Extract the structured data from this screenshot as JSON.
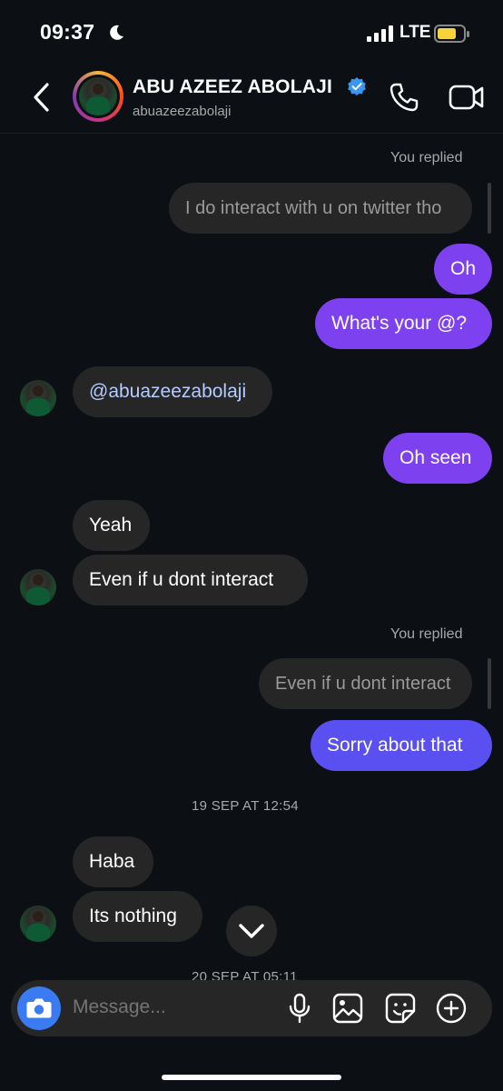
{
  "status_bar": {
    "time": "09:37",
    "network": "LTE"
  },
  "header": {
    "name": "ABU AZEEZ ABOLAJI",
    "username": "abuazeezabolaji"
  },
  "messages": {
    "reply1_label": "You replied",
    "reply1_quote": "I do interact with u on twitter tho",
    "m_oh": "Oh",
    "m_whats": "What's your @?",
    "m_handle": "@abuazeezabolaji",
    "m_ohseen": "Oh seen",
    "m_yeah": "Yeah",
    "m_evenif": "Even if u dont interact",
    "reply2_label": "You replied",
    "reply2_quote": "Even if u dont interact",
    "m_sorry": "Sorry about that",
    "date1": "19 SEP AT 12:54",
    "m_haba": "Haba",
    "m_nothing": "Its nothing",
    "date2": "20 SEP AT 05:11"
  },
  "composer": {
    "placeholder": "Message..."
  },
  "colors": {
    "outgoing": "#7d41f0",
    "outgoing_alt": "#5a4ff0",
    "incoming": "#262626",
    "camera": "#3a7bf2",
    "verified": "#3897f0"
  },
  "icons": [
    "moon-icon",
    "signal-icon",
    "battery-icon",
    "back-icon",
    "verified-icon",
    "call-icon",
    "video-icon",
    "chevron-down-icon",
    "camera-icon",
    "mic-icon",
    "gallery-icon",
    "sticker-icon",
    "plus-icon"
  ]
}
